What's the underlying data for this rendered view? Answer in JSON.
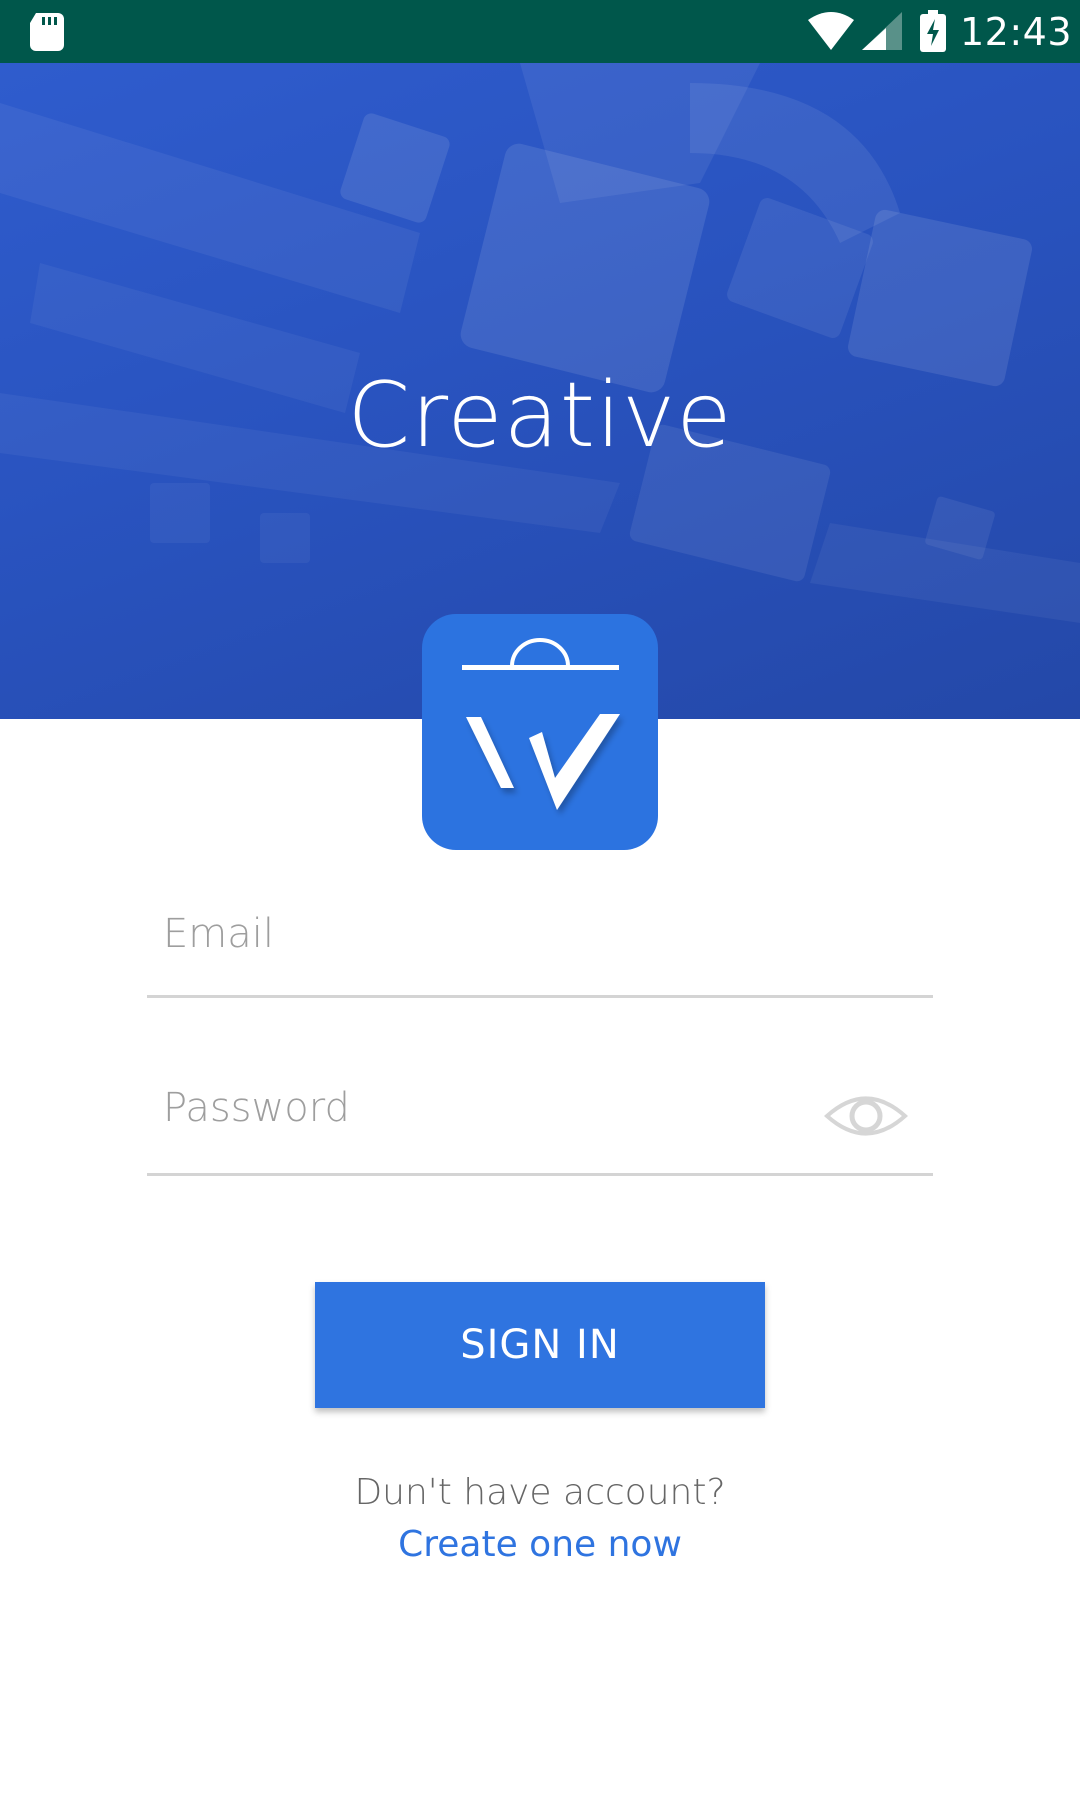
{
  "status_bar": {
    "time": "12:43",
    "icons": [
      "sd-card-icon",
      "wifi-icon",
      "cellular-signal-icon",
      "battery-charging-icon"
    ]
  },
  "hero": {
    "title": "Creative",
    "background_color": "#2953bf"
  },
  "logo": {
    "icon": "shopping-bag-w-icon",
    "color": "#2c73e0"
  },
  "form": {
    "email": {
      "placeholder": "Email",
      "value": ""
    },
    "password": {
      "placeholder": "Password",
      "value": "",
      "toggle_icon": "eye-icon"
    },
    "sign_in_label": "SIGN IN"
  },
  "footer": {
    "prompt": "Dun't have account?",
    "create_link": "Create one now"
  },
  "colors": {
    "status_bar": "#00574b",
    "accent": "#2f74e0",
    "divider": "#d4d4d4",
    "placeholder": "#9e9e9e"
  }
}
